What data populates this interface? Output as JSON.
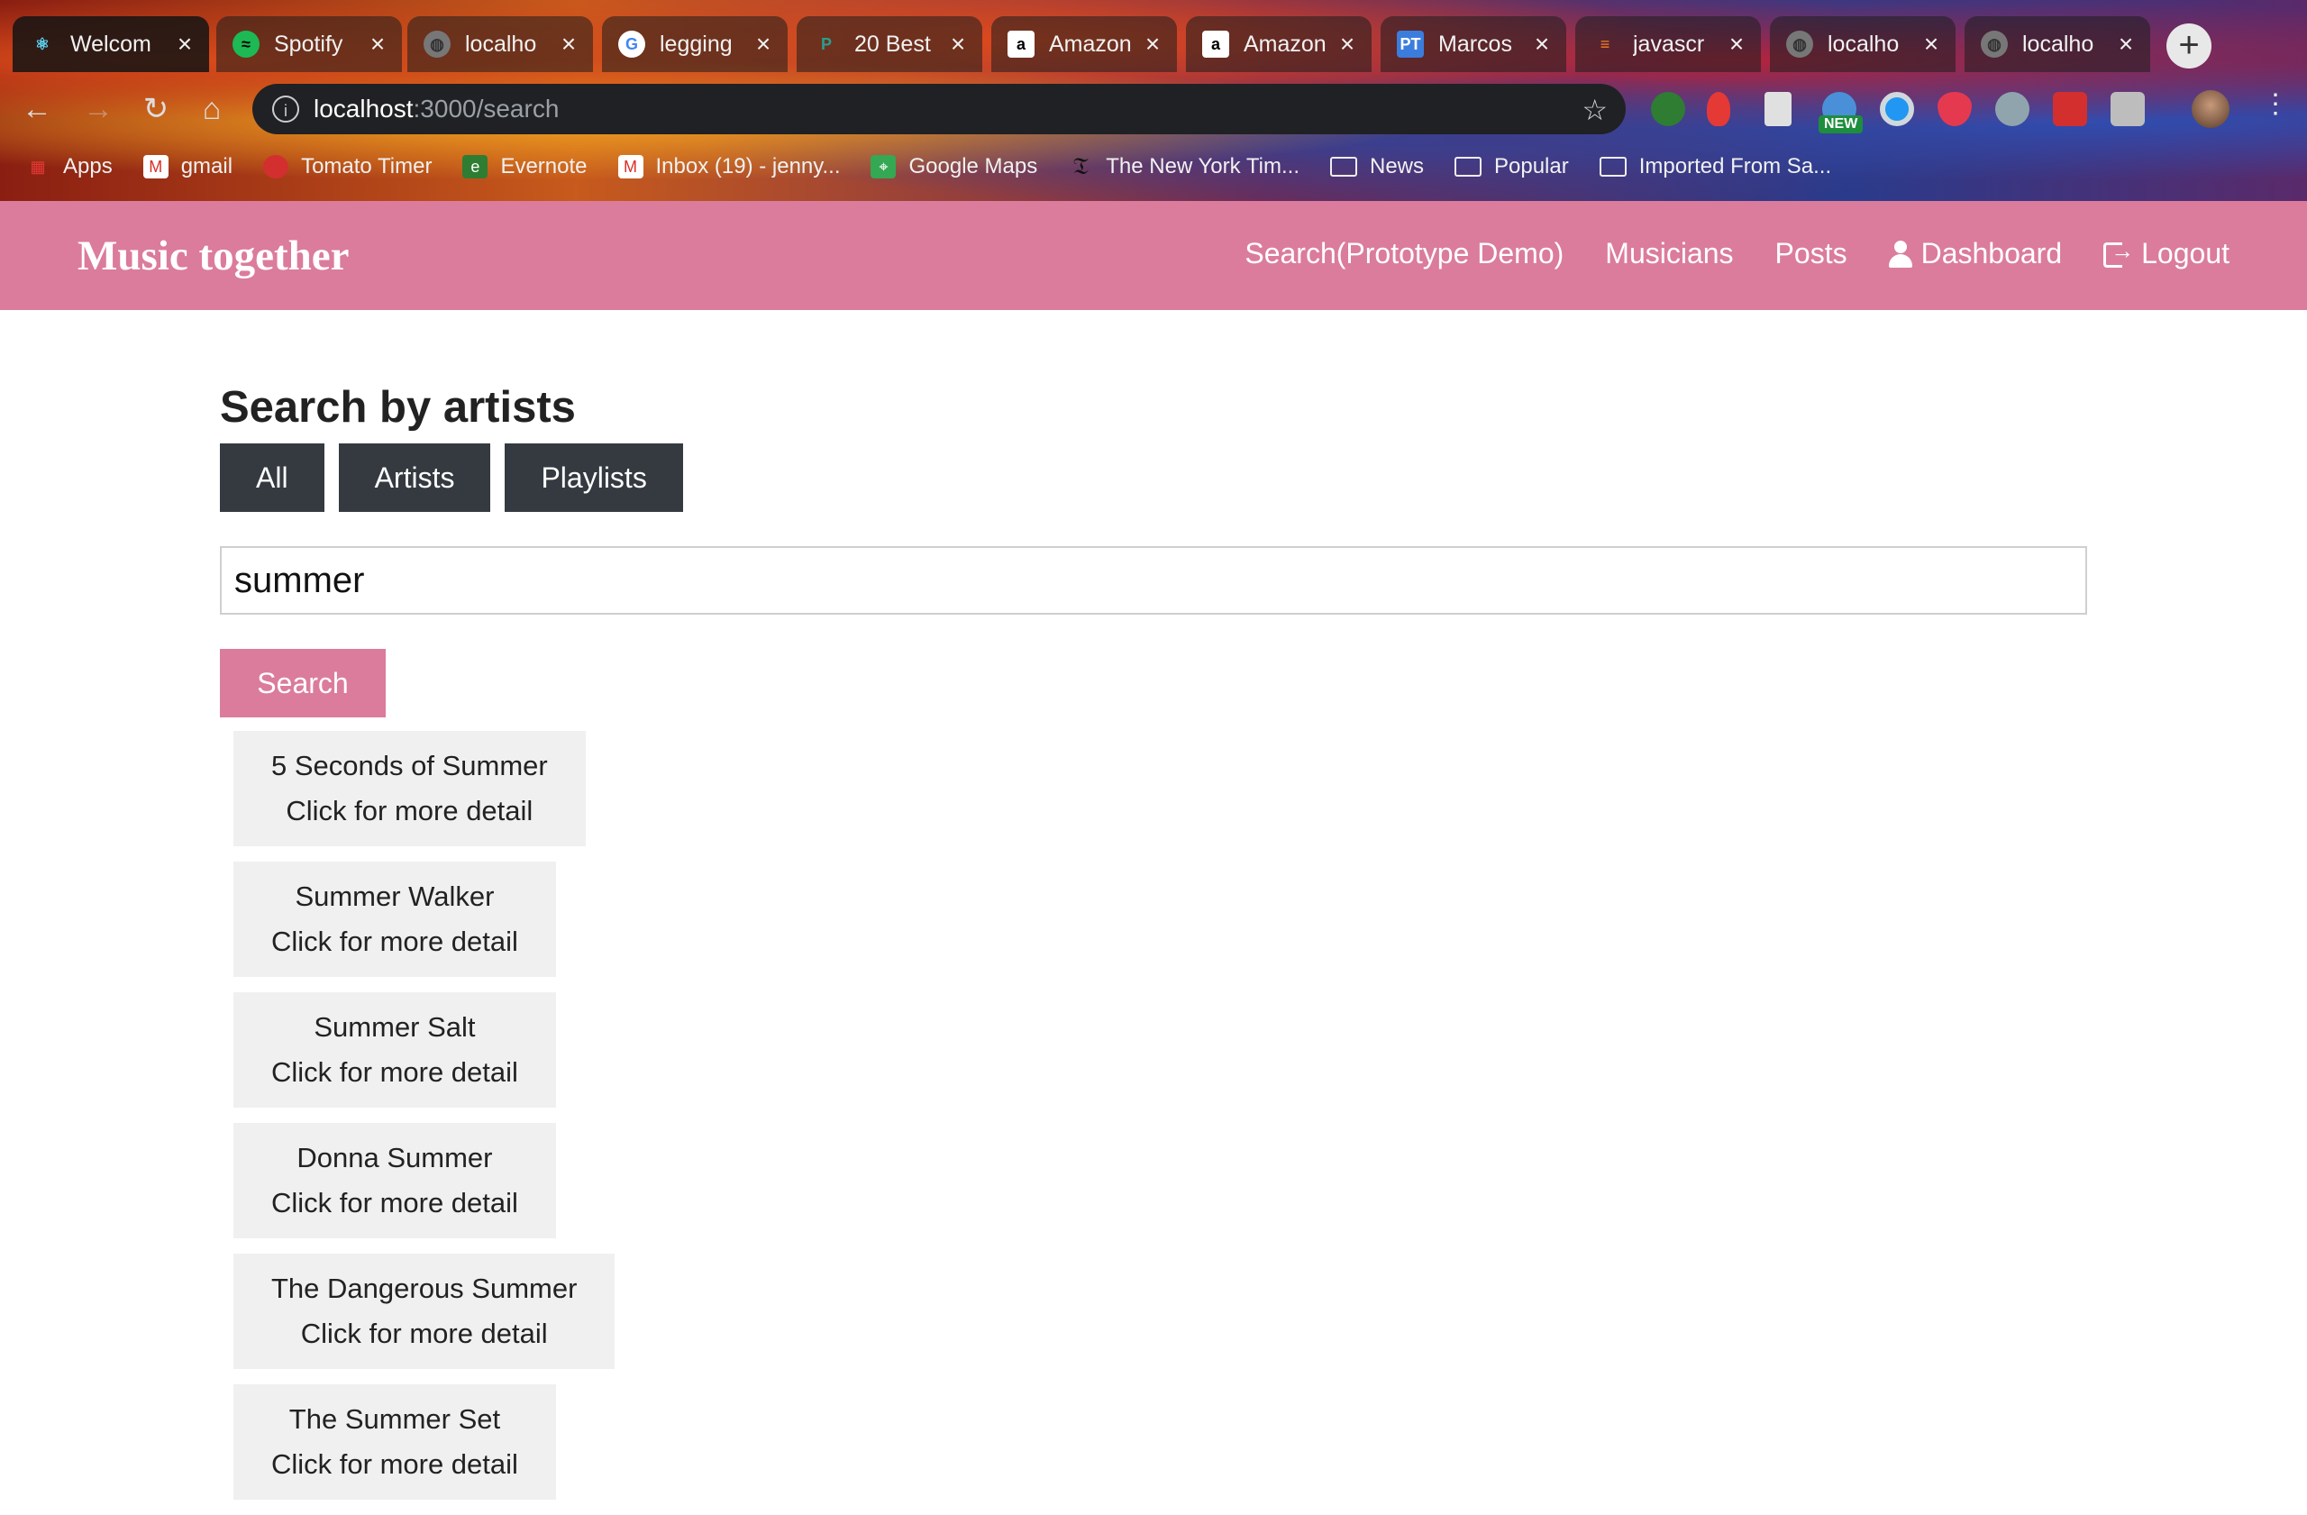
{
  "browser": {
    "tabs": [
      {
        "title": "Welcom",
        "icon": "react-icon",
        "color": "#61dafb"
      },
      {
        "title": "Spotify",
        "icon": "spotify-icon",
        "color": "#1db954"
      },
      {
        "title": "localho",
        "icon": "globe-icon",
        "color": "#aaaaaa"
      },
      {
        "title": "legging",
        "icon": "google-icon",
        "color": "#ffffff"
      },
      {
        "title": "20 Best",
        "icon": "p-logo-icon",
        "color": "#2a9d8f"
      },
      {
        "title": "Amazon",
        "icon": "amazon-icon",
        "color": "#ffffff"
      },
      {
        "title": "Amazon",
        "icon": "amazon-icon",
        "color": "#ffffff"
      },
      {
        "title": "Marcos",
        "icon": "pivotal-icon",
        "color": "#3b7ddd"
      },
      {
        "title": "javascr",
        "icon": "stackoverflow-icon",
        "color": "#f48024"
      },
      {
        "title": "localho",
        "icon": "globe-icon",
        "color": "#aaaaaa"
      },
      {
        "title": "localho",
        "icon": "globe-icon",
        "color": "#aaaaaa"
      }
    ],
    "address": {
      "host": "localhost",
      "path": ":3000/search"
    },
    "extension_badge": "NEW",
    "bookmarks": [
      {
        "label": "Apps",
        "icon": "apps-grid-icon"
      },
      {
        "label": "gmail",
        "icon": "gmail-icon"
      },
      {
        "label": "Tomato Timer",
        "icon": "tomato-icon"
      },
      {
        "label": "Evernote",
        "icon": "evernote-icon"
      },
      {
        "label": "Inbox (19) - jenny...",
        "icon": "gmail-icon"
      },
      {
        "label": "Google Maps",
        "icon": "maps-icon"
      },
      {
        "label": "The New York Tim...",
        "icon": "nyt-icon"
      },
      {
        "label": "News",
        "icon": "folder-icon"
      },
      {
        "label": "Popular",
        "icon": "folder-icon"
      },
      {
        "label": "Imported From Sa...",
        "icon": "folder-icon"
      }
    ]
  },
  "app": {
    "brand": "Music together",
    "nav": {
      "search": "Search(Prototype Demo)",
      "musicians": "Musicians",
      "posts": "Posts",
      "dashboard": "Dashboard",
      "logout": "Logout"
    },
    "heading": "Search by artists",
    "filters": {
      "all": "All",
      "artists": "Artists",
      "playlists": "Playlists"
    },
    "search_value": "summer",
    "search_button": "Search",
    "results": [
      {
        "name": "5 Seconds of Summer",
        "detail": "Click for more detail"
      },
      {
        "name": "Summer Walker",
        "detail": "Click for more detail"
      },
      {
        "name": "Summer Salt",
        "detail": "Click for more detail"
      },
      {
        "name": "Donna Summer",
        "detail": "Click for more detail"
      },
      {
        "name": "The Dangerous Summer",
        "detail": "Click for more detail"
      },
      {
        "name": "The Summer Set",
        "detail": "Click for more detail"
      }
    ],
    "colors": {
      "accent": "#db7c9c",
      "filter_button": "#343a40",
      "card": "#f0f0f0"
    }
  }
}
